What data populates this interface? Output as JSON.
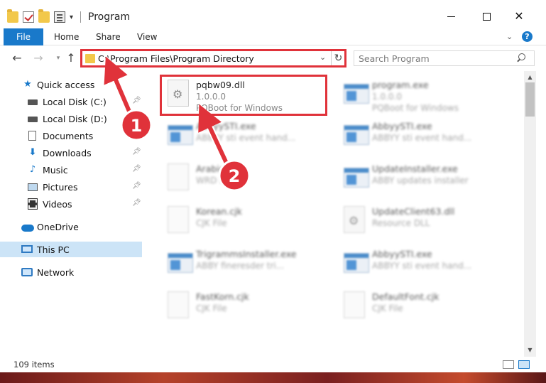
{
  "window": {
    "title": "Program",
    "controls": {
      "minimize": "minimize",
      "maximize": "maximize",
      "close": "close"
    }
  },
  "ribbon": {
    "tabs": [
      "File",
      "Home",
      "Share",
      "View"
    ],
    "help_label": "?"
  },
  "navigation": {
    "address": "C:\\Program Files\\Program Directory",
    "search_placeholder": "Search Program"
  },
  "sidebar": {
    "items": [
      {
        "label": "Quick access",
        "icon": "star-icon",
        "pinned": false
      },
      {
        "label": "Local Disk (C:)",
        "icon": "disk-icon",
        "pinned": true
      },
      {
        "label": "Local Disk (D:)",
        "icon": "disk-icon",
        "pinned": false
      },
      {
        "label": "Documents",
        "icon": "document-icon",
        "pinned": true
      },
      {
        "label": "Downloads",
        "icon": "download-icon",
        "pinned": true
      },
      {
        "label": "Music",
        "icon": "music-icon",
        "pinned": true
      },
      {
        "label": "Pictures",
        "icon": "pictures-icon",
        "pinned": true
      },
      {
        "label": "Videos",
        "icon": "video-icon",
        "pinned": true
      },
      {
        "label": "OneDrive",
        "icon": "onedrive-icon",
        "pinned": false
      },
      {
        "label": "This PC",
        "icon": "this-pc-icon",
        "pinned": false,
        "selected": true
      },
      {
        "label": "Network",
        "icon": "network-icon",
        "pinned": false
      }
    ]
  },
  "files": [
    {
      "name": "pqbw09.dll",
      "line2": "1.0.0.0",
      "line3": "PQBoot for Windows",
      "icon": "dll-icon",
      "highlighted": true
    },
    {
      "name": "program.exe",
      "line2": "1.0.0.0",
      "line3": "PQBoot for Windows",
      "icon": "program-exe-icon"
    },
    {
      "name": "AbbyySTI.exe",
      "line2": "ABBYY sti event hand...",
      "line3": "",
      "icon": "exe-icon"
    },
    {
      "name": "AbbyySTI.exe",
      "line2": "ABBYY sti event hand...",
      "line3": "",
      "icon": "exe-icon"
    },
    {
      "name": "Arabic.cjk",
      "line2": "WRD File",
      "line3": "",
      "icon": "file-icon"
    },
    {
      "name": "UpdateInstaller.exe",
      "line2": "ABBY updates installer",
      "line3": "",
      "icon": "exe-icon"
    },
    {
      "name": "Korean.cjk",
      "line2": "CJK File",
      "line3": "",
      "icon": "file-icon"
    },
    {
      "name": "UpdateClient63.dll",
      "line2": "Resource DLL",
      "line3": "",
      "icon": "dll-icon"
    },
    {
      "name": "TrigrammsInstaller.exe",
      "line2": "ABBY fineresder tri...",
      "line3": "",
      "icon": "exe-icon"
    },
    {
      "name": "AbbyySTI.exe",
      "line2": "ABBYY sti event hand...",
      "line3": "",
      "icon": "exe-icon"
    },
    {
      "name": "FastKorn.cjk",
      "line2": "CJK File",
      "line3": "",
      "icon": "file-icon"
    },
    {
      "name": "DefaultFont.cjk",
      "line2": "CJK File",
      "line3": "",
      "icon": "file-icon"
    }
  ],
  "status": {
    "item_count": "109 items"
  },
  "annotations": [
    {
      "number": "1",
      "color": "#e0323a"
    },
    {
      "number": "2",
      "color": "#e0323a"
    }
  ],
  "colors": {
    "accent": "#1979ca",
    "highlight": "#e0323a",
    "selection": "#cce4f7"
  }
}
